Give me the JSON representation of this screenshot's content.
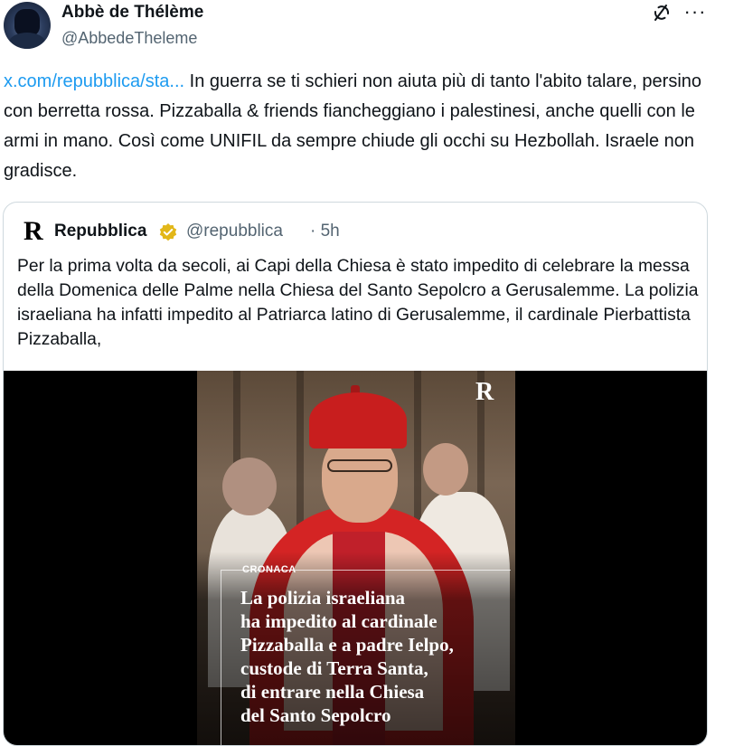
{
  "author": {
    "display_name": "Abbè de Thélème",
    "handle": "@AbbedeTheleme"
  },
  "tweet": {
    "link_text": "x.com/repubblica/sta...",
    "text": " In guerra se ti schieri non aiuta più di tanto l'abito talare, persino con berretta rossa. Pizzaballa & friends fiancheggiano i palestinesi, anche quelli con le armi in mano. Così come UNIFIL da sempre chiude gli occhi su Hezbollah. Israele non gradisce."
  },
  "quote": {
    "logo": "R",
    "name": "Repubblica",
    "handle": "@repubblica",
    "time": "· 5h",
    "text": "Per la prima volta da secoli, ai Capi della Chiesa è stato impedito di celebrare la messa della Domenica delle Palme nella Chiesa del Santo Sepolcro a Gerusalemme. La polizia israeliana ha infatti impedito al Patriarca latino di Gerusalemme, il cardinale Pierbattista Pizzaballa,",
    "media": {
      "logo": "R",
      "kicker": "CRONACA",
      "headline_lines": [
        "La polizia israeliana",
        "ha impedito al cardinale",
        "Pizzaballa e a padre Ielpo,",
        "custode di Terra Santa,",
        "di entrare nella Chiesa",
        "del Santo Sepolcro"
      ]
    }
  },
  "icons": {
    "grok": "grok-icon",
    "more": "more-icon",
    "verified": "verified-badge-icon"
  },
  "colors": {
    "link": "#1d9bf0",
    "verified": "#e2b719",
    "secondary_text": "#536471"
  }
}
